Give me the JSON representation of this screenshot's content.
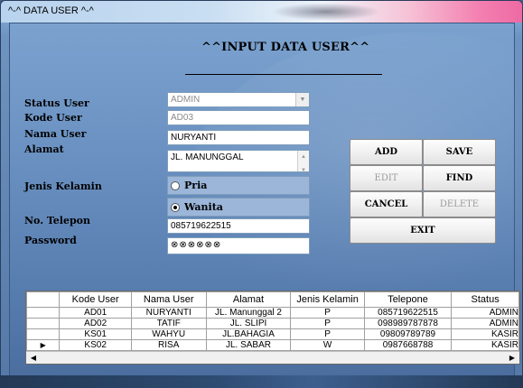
{
  "window": {
    "title": "^-^ DATA USER ^-^"
  },
  "form": {
    "heading": "^^INPUT DATA USER^^",
    "labels": {
      "status_user": "Status User",
      "kode_user": "Kode User",
      "nama_user": "Nama User",
      "alamat": "Alamat",
      "jenis_kelamin": "Jenis Kelamin",
      "no_telepon": "No. Telepon",
      "password": "Password"
    },
    "status_user_value": "ADMIN",
    "kode_user_value": "AD03",
    "nama_user_value": "NURYANTI",
    "alamat_value": "JL. MANUNGGAL",
    "gender_options": [
      {
        "label": "Pria",
        "selected": false
      },
      {
        "label": "Wanita",
        "selected": true
      }
    ],
    "no_telepon_value": "085719622515",
    "password_value": "⊗⊗⊗⊗⊗⊗"
  },
  "buttons": {
    "add": "ADD",
    "save": "SAVE",
    "edit": "EDIT",
    "find": "FIND",
    "cancel": "CANCEL",
    "delete": "DELETE",
    "exit": "EXIT"
  },
  "grid": {
    "columns": [
      "Kode User",
      "Nama User",
      "Alamat",
      "Jenis Kelamin",
      "Telepone",
      "Status"
    ],
    "rows": [
      [
        "AD01",
        "NURYANTI",
        "JL. Manunggal 2",
        "P",
        "085719622515",
        "ADMIN"
      ],
      [
        "AD02",
        "TATIF",
        "JL. SLIPI",
        "P",
        "098989787878",
        "ADMIN"
      ],
      [
        "KS01",
        "WAHYU",
        "JL.BAHAGIA",
        "P",
        "09809789789",
        "KASIR"
      ],
      [
        "KS02",
        "RISA",
        "JL. SABAR",
        "W",
        "0987668788",
        "KASIR"
      ]
    ],
    "current_row_indicator": "▶"
  },
  "colors": {
    "client_bg": "#6b92c2",
    "radio_row_bg": "#9bb6d9"
  }
}
